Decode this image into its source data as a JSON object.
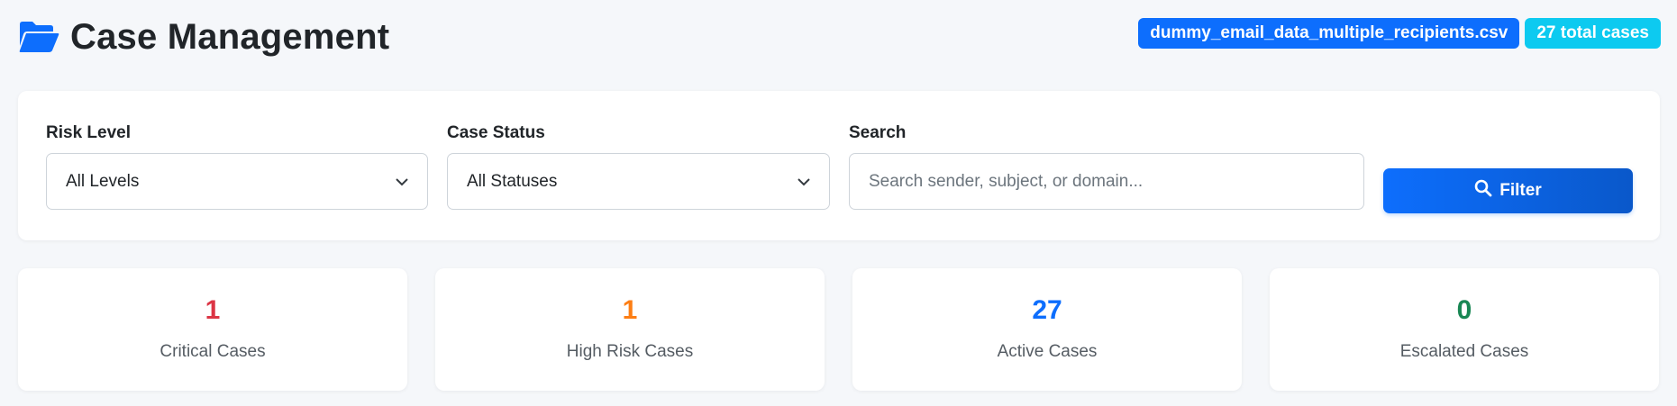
{
  "header": {
    "title": "Case Management",
    "file_badge": "dummy_email_data_multiple_recipients.csv",
    "count_badge": "27 total cases",
    "title_icon": "folder-open-icon"
  },
  "filters": {
    "risk_level": {
      "label": "Risk Level",
      "value": "All Levels"
    },
    "case_status": {
      "label": "Case Status",
      "value": "All Statuses"
    },
    "search": {
      "label": "Search",
      "placeholder": "Search sender, subject, or domain..."
    },
    "filter_button": "Filter"
  },
  "stats": [
    {
      "value": "1",
      "label": "Critical Cases",
      "color": "#dc3545"
    },
    {
      "value": "1",
      "label": "High Risk Cases",
      "color": "#fd7e14"
    },
    {
      "value": "27",
      "label": "Active Cases",
      "color": "#0d6efd"
    },
    {
      "value": "0",
      "label": "Escalated Cases",
      "color": "#198754"
    }
  ],
  "colors": {
    "primary": "#0d6efd",
    "info": "#0dcaf0"
  }
}
